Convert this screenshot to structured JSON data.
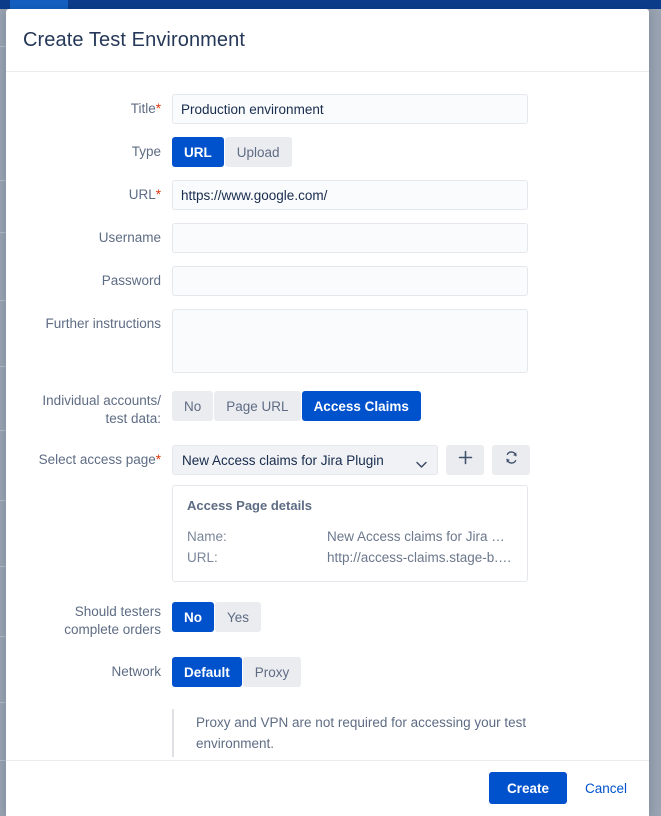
{
  "dialog": {
    "title": "Create Test Environment"
  },
  "form": {
    "title_field": {
      "label": "Title",
      "required": true,
      "value": "Production environment"
    },
    "type_field": {
      "label": "Type",
      "options": [
        "URL",
        "Upload"
      ],
      "selected": "URL"
    },
    "url_field": {
      "label": "URL",
      "required": true,
      "value": "https://www.google.com/"
    },
    "username_field": {
      "label": "Username",
      "value": ""
    },
    "password_field": {
      "label": "Password",
      "value": ""
    },
    "further_instructions_field": {
      "label": "Further instructions",
      "value": ""
    },
    "individual_accounts_field": {
      "label_line1": "Individual accounts/",
      "label_line2": "test data:",
      "options": [
        "No",
        "Page URL",
        "Access Claims"
      ],
      "selected": "Access Claims"
    },
    "select_access_page_field": {
      "label": "Select access page",
      "required": true,
      "value": "New Access claims for Jira Plugin",
      "add_icon": "plus-icon",
      "refresh_icon": "refresh-icon"
    },
    "access_page_details": {
      "heading": "Access Page details",
      "rows": [
        {
          "key": "Name:",
          "value": "New Access claims for Jira Plu..."
        },
        {
          "key": "URL:",
          "value": "http://access-claims.stage-b.s..."
        }
      ]
    },
    "complete_orders_field": {
      "label_line1": "Should testers",
      "label_line2": "complete orders",
      "options": [
        "No",
        "Yes"
      ],
      "selected": "No"
    },
    "network_field": {
      "label": "Network",
      "options": [
        "Default",
        "Proxy"
      ],
      "selected": "Default"
    },
    "network_note": "Proxy and VPN are not required for accessing your test environment."
  },
  "footer": {
    "create_label": "Create",
    "cancel_label": "Cancel"
  },
  "colors": {
    "accent": "#0052CC",
    "required": "#DE350B",
    "title": "#253858",
    "label": "#5E6C84",
    "inactive_segment": "#EBECF0"
  }
}
